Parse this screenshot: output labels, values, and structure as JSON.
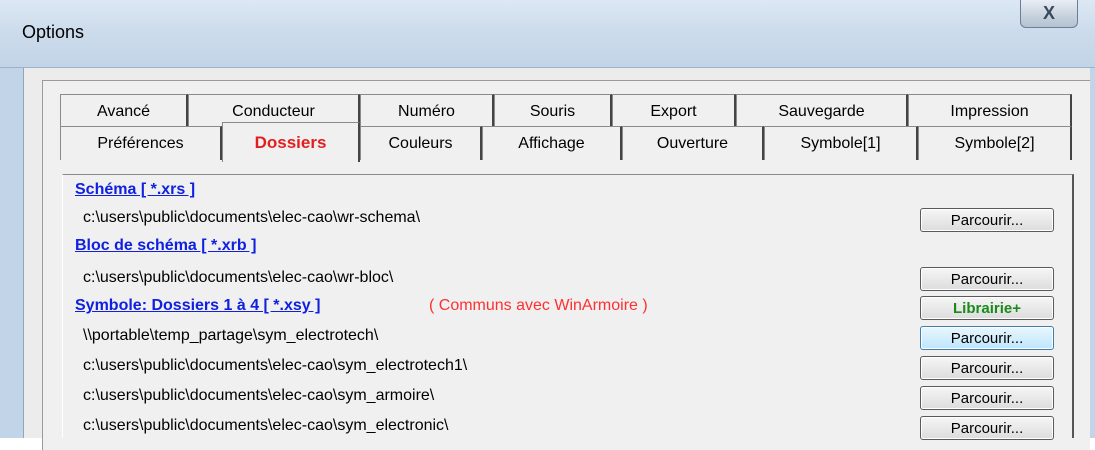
{
  "window": {
    "title": "Options",
    "close_glyph": "X"
  },
  "tabs_row1": [
    "Avancé",
    "Conducteur",
    "Numéro",
    "Souris",
    "Export",
    "Sauvegarde",
    "Impression"
  ],
  "tabs_row2": [
    "Préférences",
    "Dossiers",
    "Couleurs",
    "Affichage",
    "Ouverture",
    "Symbole[1]",
    "Symbole[2]"
  ],
  "active_tab": "Dossiers",
  "sections": {
    "schema": {
      "title": "Schéma [ *.xrs ]",
      "path": "c:\\users\\public\\documents\\elec-cao\\wr-schema\\",
      "button": "Parcourir..."
    },
    "bloc": {
      "title": "Bloc de schéma [ *.xrb ]",
      "path": "c:\\users\\public\\documents\\elec-cao\\wr-bloc\\",
      "button": "Parcourir..."
    },
    "symbole": {
      "title": "Symbole: Dossiers 1 à 4 [ *.xsy ]",
      "note": "( Communs avec WinArmoire )",
      "library_button": "Librairie+",
      "paths": [
        "\\\\portable\\temp_partage\\sym_electrotech\\",
        "c:\\users\\public\\documents\\elec-cao\\sym_electrotech1\\",
        "c:\\users\\public\\documents\\elec-cao\\sym_armoire\\",
        "c:\\users\\public\\documents\\elec-cao\\sym_electronic\\"
      ],
      "button": "Parcourir..."
    }
  },
  "colors": {
    "active_tab": "#e02020",
    "section_title": "#1020e0",
    "note": "#ff3030",
    "library_button": "#1a8a1a"
  }
}
